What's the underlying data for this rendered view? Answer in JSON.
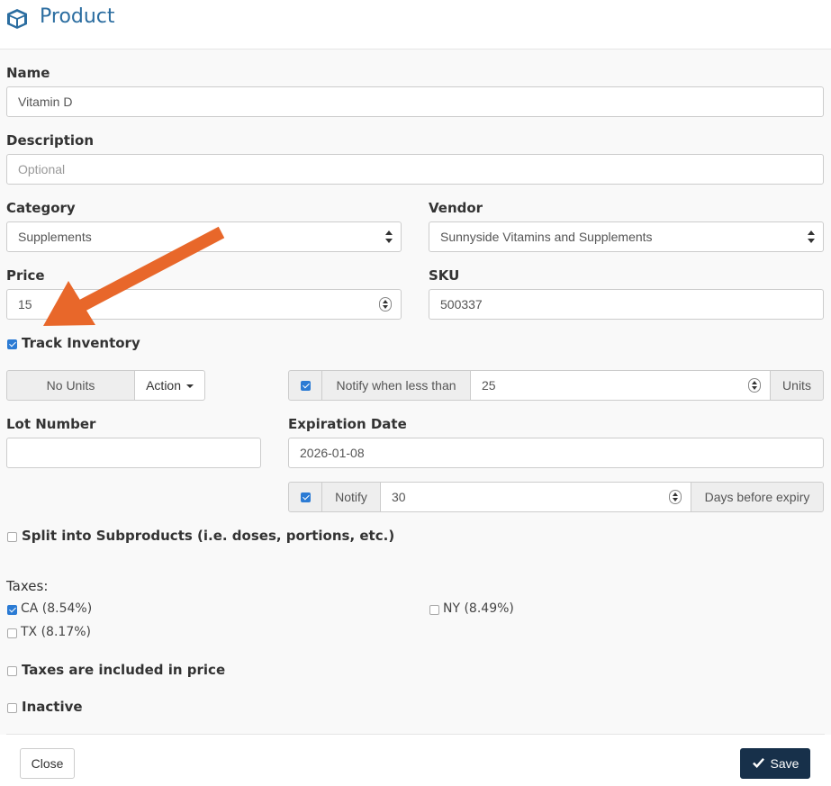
{
  "header": {
    "title": "Product",
    "icon": "cube-icon"
  },
  "form": {
    "name": {
      "label": "Name",
      "value": "Vitamin D"
    },
    "description": {
      "label": "Description",
      "placeholder": "Optional"
    },
    "category": {
      "label": "Category",
      "value": "Supplements"
    },
    "vendor": {
      "label": "Vendor",
      "value": "Sunnyside Vitamins and Supplements"
    },
    "price": {
      "label": "Price",
      "value": "15"
    },
    "sku": {
      "label": "SKU",
      "value": "500337"
    },
    "track_inventory": {
      "label": "Track Inventory",
      "checked": true
    },
    "units": {
      "value": "No Units",
      "action_label": "Action"
    },
    "notify_low": {
      "checked": true,
      "label": "Notify when less than",
      "value": "25",
      "suffix": "Units"
    },
    "lot_number": {
      "label": "Lot Number",
      "value": ""
    },
    "expiration": {
      "label": "Expiration Date",
      "value": "2026-01-08"
    },
    "notify_expiry": {
      "checked": true,
      "label": "Notify",
      "value": "30",
      "suffix": "Days before expiry"
    },
    "split": {
      "label": "Split into Subproducts (i.e. doses, portions, etc.)",
      "checked": false
    },
    "taxes": {
      "label": "Taxes:",
      "items": [
        {
          "label": "CA (8.54%)",
          "checked": true
        },
        {
          "label": "NY (8.49%)",
          "checked": false
        },
        {
          "label": "TX (8.17%)",
          "checked": false
        }
      ]
    },
    "taxes_included": {
      "label": "Taxes are included in price",
      "checked": false
    },
    "inactive": {
      "label": "Inactive",
      "checked": false
    }
  },
  "footer": {
    "close_label": "Close",
    "save_label": "Save"
  },
  "colors": {
    "accent": "#2b6da0",
    "annotation_arrow": "#e8672a",
    "save_button": "#17304a"
  }
}
